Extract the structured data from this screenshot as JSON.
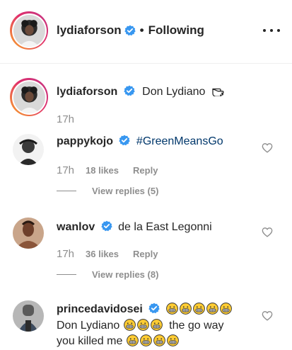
{
  "header": {
    "username": "lydiaforson",
    "separator": "•",
    "follow_status": "Following"
  },
  "caption": {
    "username": "lydiaforson",
    "text": "Don Lydiano",
    "time": "17h"
  },
  "comments": [
    {
      "username": "pappykojo",
      "text": "#GreenMeansGo",
      "time": "17h",
      "likes": "18 likes",
      "reply_label": "Reply",
      "view_replies": "View replies (5)"
    },
    {
      "username": "wanlov",
      "text": "de la East Legonni",
      "time": "17h",
      "likes": "36 likes",
      "reply_label": "Reply",
      "view_replies": "View replies (8)"
    },
    {
      "username": "princedavidosei",
      "line2_text": "Don Lydiano",
      "line2_suffix": "the go way",
      "line3_text": "you killed me"
    }
  ],
  "icons": {
    "verified": "verified-badge-icon",
    "more": "more-options-icon",
    "heart": "heart-outline-icon",
    "emoji": "grinning-emoji-icon",
    "pointing_hand": "pointing-hand-icon"
  },
  "colors": {
    "verified_blue": "#3897f0",
    "hashtag": "#00376b",
    "muted": "#8e8e8e",
    "emoji_yellow": "#ffcc33"
  }
}
